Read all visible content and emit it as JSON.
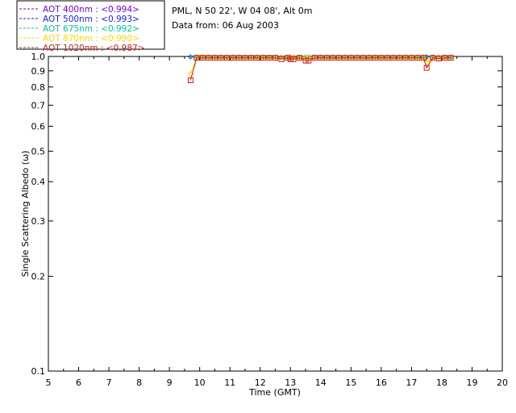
{
  "header": {
    "site_line": "PML, N 50 22', W 04 08', Alt 0m",
    "date_line": "Data from: 06 Aug 2003"
  },
  "chart_data": {
    "type": "scatter",
    "xlabel": "Time (GMT)",
    "ylabel": "Single Scattering Albedo (ω)",
    "xlim": [
      5,
      20
    ],
    "ylim": [
      0.1,
      1.0
    ],
    "yscale": "log",
    "grid": false,
    "legend_position": "top-left-outside",
    "x_ticks": [
      5,
      6,
      7,
      8,
      9,
      10,
      11,
      12,
      13,
      14,
      15,
      16,
      17,
      18,
      19,
      20
    ],
    "y_ticks": [
      {
        "value": 1.0,
        "label": "1.0"
      },
      {
        "value": 0.9,
        "label": "0.9"
      },
      {
        "value": 0.8,
        "label": "0.8"
      },
      {
        "value": 0.7,
        "label": "0.7"
      },
      {
        "value": 0.6,
        "label": "0.6"
      },
      {
        "value": 0.5,
        "label": "0.5"
      },
      {
        "value": 0.4,
        "label": "0.4"
      },
      {
        "value": 0.3,
        "label": "0.3"
      },
      {
        "value": 0.2,
        "label": "0.2"
      },
      {
        "value": 0.1,
        "label": "0.1"
      }
    ],
    "x": [
      9.7,
      9.9,
      10.1,
      10.3,
      10.5,
      10.7,
      10.9,
      11.1,
      11.3,
      11.5,
      11.7,
      11.9,
      12.1,
      12.3,
      12.5,
      12.7,
      12.9,
      13.0,
      13.1,
      13.3,
      13.5,
      13.6,
      13.8,
      14.0,
      14.2,
      14.4,
      14.6,
      14.8,
      15.0,
      15.2,
      15.4,
      15.6,
      15.8,
      16.0,
      16.2,
      16.4,
      16.6,
      16.8,
      17.0,
      17.2,
      17.4,
      17.5,
      17.7,
      17.9,
      18.1,
      18.3
    ],
    "series": [
      {
        "name": "AOT  400nm : <0.994>",
        "color": "#7b00d6",
        "marker": "plus",
        "values": [
          0.997,
          0.997,
          0.997,
          0.997,
          0.997,
          0.997,
          0.997,
          0.997,
          0.997,
          0.997,
          0.997,
          0.997,
          0.997,
          0.997,
          0.997,
          0.997,
          0.997,
          0.997,
          0.997,
          0.997,
          0.997,
          0.997,
          0.997,
          0.997,
          0.997,
          0.997,
          0.997,
          0.997,
          0.997,
          0.997,
          0.997,
          0.997,
          0.997,
          0.997,
          0.997,
          0.997,
          0.997,
          0.997,
          0.997,
          0.997,
          0.997,
          0.997,
          0.997,
          0.997,
          0.997,
          0.997
        ]
      },
      {
        "name": "AOT  500nm : <0.993>",
        "color": "#1a1aff",
        "marker": "asterisk",
        "values": [
          0.996,
          0.996,
          0.996,
          0.996,
          0.996,
          0.996,
          0.996,
          0.996,
          0.996,
          0.996,
          0.996,
          0.996,
          0.996,
          0.996,
          0.996,
          0.996,
          0.996,
          0.996,
          0.996,
          0.996,
          0.996,
          0.996,
          0.996,
          0.996,
          0.996,
          0.996,
          0.996,
          0.996,
          0.996,
          0.996,
          0.996,
          0.996,
          0.996,
          0.996,
          0.996,
          0.996,
          0.996,
          0.996,
          0.996,
          0.996,
          0.996,
          0.996,
          0.996,
          0.996,
          0.996,
          0.996
        ]
      },
      {
        "name": "AOT  675nm : <0.992>",
        "color": "#00c896",
        "marker": "dot",
        "values": [
          0.995,
          0.995,
          0.995,
          0.995,
          0.995,
          0.995,
          0.995,
          0.995,
          0.995,
          0.995,
          0.995,
          0.995,
          0.995,
          0.995,
          0.995,
          0.995,
          0.995,
          0.995,
          0.995,
          0.995,
          0.995,
          0.995,
          0.995,
          0.995,
          0.995,
          0.995,
          0.995,
          0.995,
          0.995,
          0.995,
          0.995,
          0.995,
          0.995,
          0.995,
          0.995,
          0.995,
          0.995,
          0.995,
          0.995,
          0.995,
          0.995,
          0.995,
          0.995,
          0.995,
          0.995,
          0.995
        ]
      },
      {
        "name": "AOT  870nm : <0.990>",
        "color": "#ffd700",
        "marker": "diamond",
        "values": [
          0.88,
          0.993,
          0.993,
          0.993,
          0.993,
          0.993,
          0.993,
          0.993,
          0.993,
          0.993,
          0.993,
          0.993,
          0.993,
          0.993,
          0.993,
          0.993,
          0.993,
          0.993,
          0.993,
          0.993,
          0.993,
          0.993,
          0.993,
          0.993,
          0.993,
          0.993,
          0.993,
          0.993,
          0.993,
          0.993,
          0.993,
          0.993,
          0.993,
          0.993,
          0.993,
          0.993,
          0.993,
          0.993,
          0.993,
          0.993,
          0.993,
          0.96,
          0.993,
          0.993,
          0.993,
          0.993
        ]
      },
      {
        "name": "AOT 1020nm : <0.987>",
        "color": "#c81e1e",
        "marker": "square",
        "values": [
          0.84,
          0.99,
          0.99,
          0.99,
          0.99,
          0.99,
          0.99,
          0.99,
          0.99,
          0.99,
          0.99,
          0.99,
          0.99,
          0.99,
          0.99,
          0.98,
          0.99,
          0.98,
          0.98,
          0.99,
          0.97,
          0.97,
          0.99,
          0.99,
          0.99,
          0.99,
          0.99,
          0.99,
          0.99,
          0.99,
          0.99,
          0.99,
          0.99,
          0.99,
          0.99,
          0.99,
          0.99,
          0.99,
          0.99,
          0.99,
          0.99,
          0.92,
          0.99,
          0.985,
          0.99,
          0.99
        ]
      }
    ]
  }
}
